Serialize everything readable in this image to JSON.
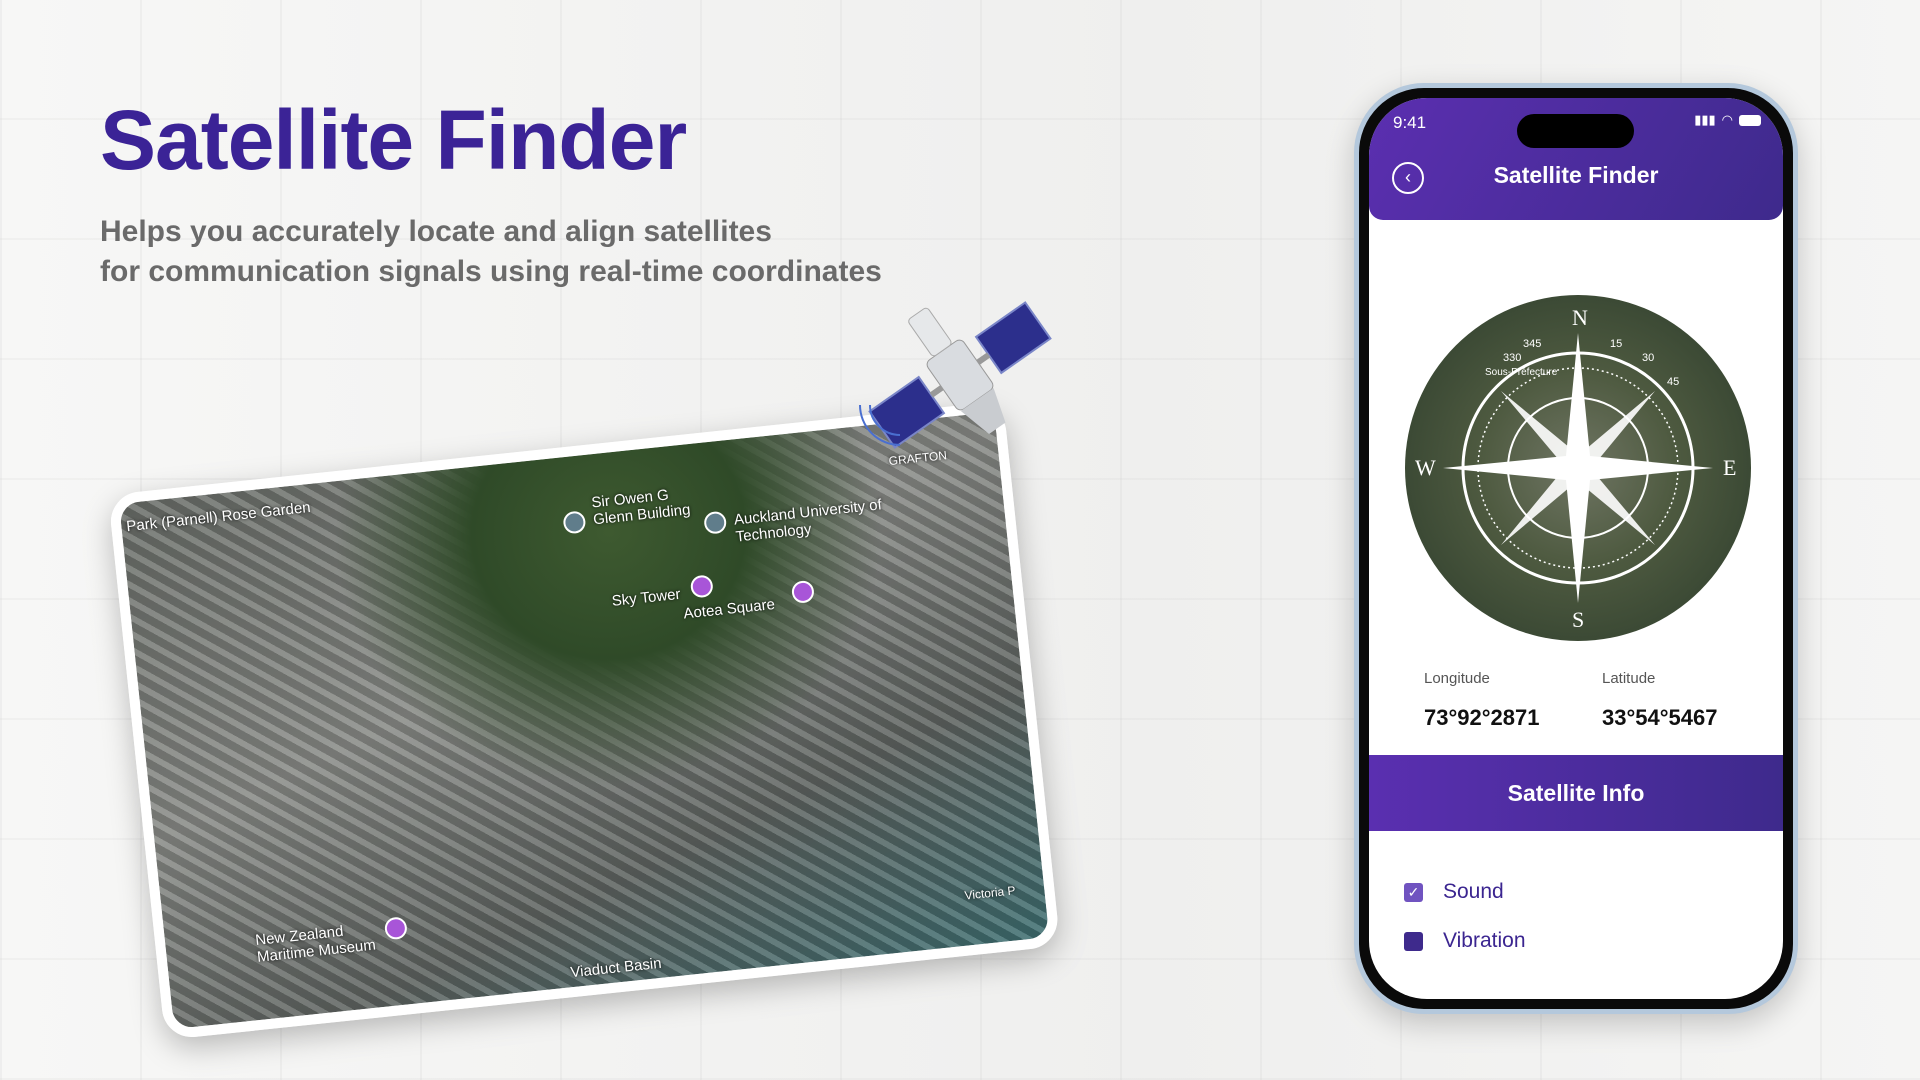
{
  "hero": {
    "title": "Satellite Finder",
    "subtitle_line1": "Helps you accurately locate and align satellites",
    "subtitle_line2": "for communication signals using real-time coordinates"
  },
  "map_card": {
    "labels": [
      "Park (Parnell) Rose Garden",
      "Sir Owen G Glenn Building",
      "GRAFTON",
      "Auckland University of Technology",
      "Sky Tower",
      "Aotea Square",
      "New Zealand Maritime Museum",
      "Viaduct Basin",
      "Victoria P"
    ]
  },
  "phone": {
    "status_time": "9:41",
    "header_title": "Satellite Finder",
    "compass": {
      "north": "N",
      "south": "S",
      "east": "E",
      "west": "W",
      "place_label": "Sous-Préfecture",
      "ticks": [
        "345",
        "15",
        "30",
        "45",
        "330"
      ]
    },
    "longitude": {
      "label": "Longitude",
      "value": "73°92°2871"
    },
    "latitude": {
      "label": "Latitude",
      "value": "33°54°5467"
    },
    "satellite_info_button": "Satellite Info",
    "options": [
      {
        "label": "Sound",
        "checked": true
      },
      {
        "label": "Vibration",
        "checked": false
      }
    ]
  },
  "colors": {
    "brand": "#3b2396",
    "accent": "#5a2fb0"
  }
}
